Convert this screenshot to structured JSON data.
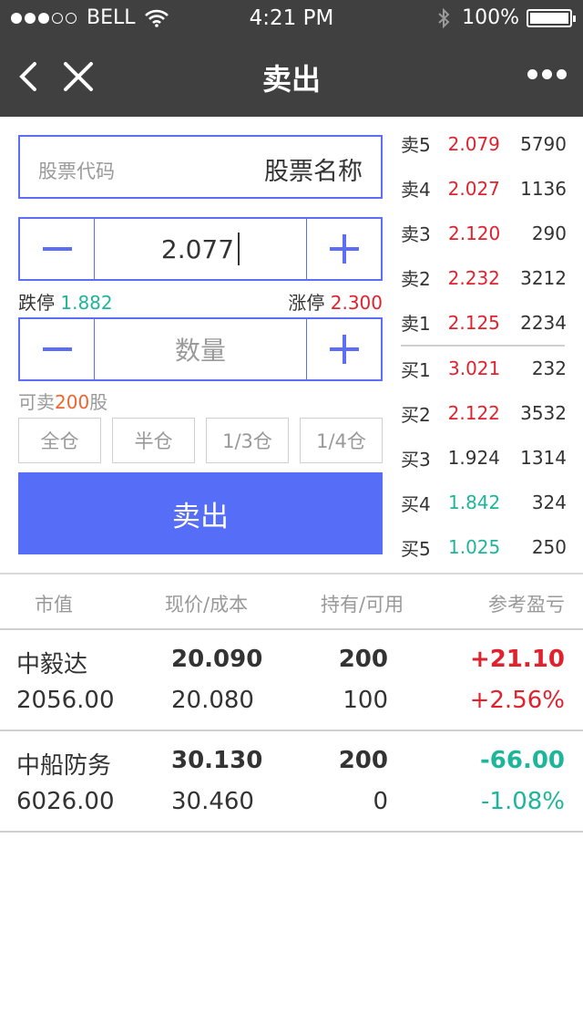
{
  "status_bar": {
    "carrier": "BELL",
    "time": "4:21 PM",
    "battery": "100%",
    "signal_dots_filled": 3,
    "signal_dots_total": 5
  },
  "nav": {
    "title": "卖出",
    "back_icon": "chevron-left-icon",
    "close_icon": "close-icon",
    "more_icon": "more-dots-icon"
  },
  "stock": {
    "code_placeholder": "股票代码",
    "name_placeholder": "股票名称"
  },
  "price": {
    "value": "2.077",
    "limit_down_label": "跌停",
    "limit_down": "1.882",
    "limit_up_label": "涨停",
    "limit_up": "2.300"
  },
  "quantity": {
    "placeholder": "数量"
  },
  "sellable": {
    "prefix": "可卖",
    "amount": "200",
    "suffix": "股"
  },
  "position_buttons": [
    "全仓",
    "半仓",
    "1/3仓",
    "1/4仓"
  ],
  "sell_button": "卖出",
  "order_book": {
    "asks": [
      {
        "label": "卖5",
        "price": "2.079",
        "volume": "5790",
        "color": "red"
      },
      {
        "label": "卖4",
        "price": "2.027",
        "volume": "1136",
        "color": "red"
      },
      {
        "label": "卖3",
        "price": "2.120",
        "volume": "290",
        "color": "red"
      },
      {
        "label": "卖2",
        "price": "2.232",
        "volume": "3212",
        "color": "red"
      },
      {
        "label": "卖1",
        "price": "2.125",
        "volume": "2234",
        "color": "red"
      }
    ],
    "bids": [
      {
        "label": "买1",
        "price": "3.021",
        "volume": "232",
        "color": "red"
      },
      {
        "label": "买2",
        "price": "2.122",
        "volume": "3532",
        "color": "red"
      },
      {
        "label": "买3",
        "price": "1.924",
        "volume": "1314",
        "color": "neutral"
      },
      {
        "label": "买4",
        "price": "1.842",
        "volume": "324",
        "color": "green"
      },
      {
        "label": "买5",
        "price": "1.025",
        "volume": "250",
        "color": "green"
      }
    ]
  },
  "holdings": {
    "headers": [
      "市值",
      "现价/成本",
      "持有/可用",
      "参考盈亏"
    ],
    "rows": [
      {
        "name": "中毅达",
        "market_value": "2056.00",
        "price": "20.090",
        "cost": "20.080",
        "held": "200",
        "available": "100",
        "pnl": "+21.10",
        "pnl_pct": "+2.56%",
        "color": "red"
      },
      {
        "name": "中船防务",
        "market_value": "6026.00",
        "price": "30.130",
        "cost": "30.460",
        "held": "200",
        "available": "0",
        "pnl": "-66.00",
        "pnl_pct": "-1.08%",
        "color": "green"
      }
    ]
  },
  "colors": {
    "accent": "#566df8",
    "red": "#e0222e",
    "green": "#1fb59a",
    "orange": "#f0642d",
    "nav_bg": "#404040"
  }
}
